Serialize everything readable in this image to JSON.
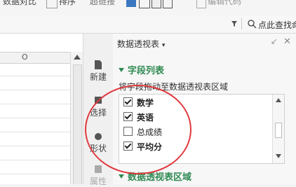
{
  "ribbon": {
    "item1": "数据对比",
    "item2": "排序",
    "item3": "超链接",
    "item4": "编辑代码"
  },
  "toolbar2": {
    "search_label": "点此查找命令"
  },
  "sheet": {
    "column_label": "O"
  },
  "sidebar": {
    "new_label": "新建",
    "select_label": "选择",
    "shape_label": "形状",
    "property_label": "属性"
  },
  "panel": {
    "title": "数据透视表",
    "field_section_title": "字段列表",
    "hint": "将字段拖动至数据透视表区域",
    "fields": [
      {
        "label": "数学",
        "checked": true
      },
      {
        "label": "英语",
        "checked": true
      },
      {
        "label": "总成绩",
        "checked": false
      },
      {
        "label": "平均分",
        "checked": true
      }
    ],
    "area_section_title": "数据透视表区域"
  },
  "colors": {
    "accent_green": "#2f8a52",
    "highlight_circle": "#e0393e"
  }
}
